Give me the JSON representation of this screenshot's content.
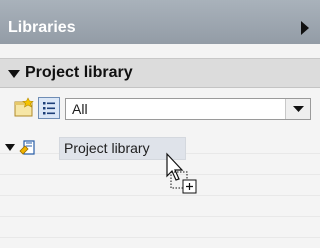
{
  "panel": {
    "title": "Libraries",
    "collapse_icon": "triangle-right-icon"
  },
  "section": {
    "title": "Project library",
    "expander_icon": "triangle-down-icon"
  },
  "toolbar": {
    "new_icon": "new-library-icon",
    "view_icon": "list-view-icon",
    "filter": {
      "value": "All",
      "dropdown_icon": "chevron-down-icon"
    }
  },
  "tree": {
    "items": [
      {
        "label": "Project library",
        "icon": "library-book-icon",
        "expanded": true,
        "highlighted": true
      }
    ]
  },
  "cursor": {
    "icon": "drag-copy-cursor-icon"
  },
  "colors": {
    "titlebar": "#9aa3ad",
    "section_header": "#dcdcdc",
    "selection": "#dfe3ea",
    "accent_blue": "#2a5fa8"
  }
}
